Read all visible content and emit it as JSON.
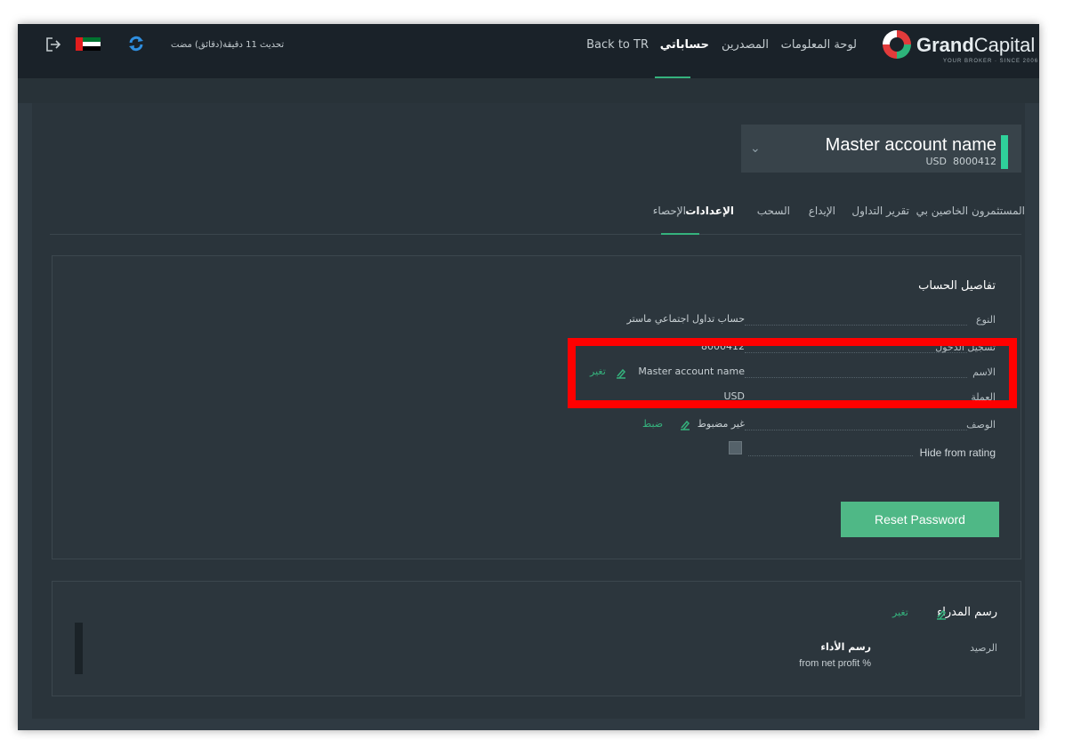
{
  "brand": {
    "name_bold": "Grand",
    "name_light": "Capital",
    "tagline": "YOUR BROKER · SINCE 2006"
  },
  "nav": {
    "dashboard": "لوحة المعلومات",
    "sources": "المصدرين",
    "my_accounts": "حساباتي",
    "back": "Back to TR"
  },
  "sync_status": "تحديث 11 دقيقة(دقائق) مضت",
  "account": {
    "name": "Master account name",
    "currency": "USD",
    "number": "8000412"
  },
  "tabs": [
    "المستثمرون الخاصين بي",
    "تقرير التداول",
    "الإيداع",
    "السحب",
    "الإعدادات",
    "الإحصاء"
  ],
  "details": {
    "title": "تفاصيل الحساب",
    "rows": [
      {
        "label": "النوع",
        "value": "حساب تداول اجتماعي ماستر"
      },
      {
        "label": "تسجيل الدخول",
        "value": "8000412"
      },
      {
        "label": "الاسم",
        "value": "Master account name",
        "edit": "تغير"
      },
      {
        "label": "العملة",
        "value": "USD"
      },
      {
        "label": "الوصف",
        "value": "غير مضبوط",
        "edit": "ضبط"
      },
      {
        "label": "Hide from rating"
      }
    ],
    "reset_button": "Reset Password"
  },
  "fee": {
    "title": "رسم المدراء",
    "edit": "تغير",
    "balance_label": "الرصيد",
    "perf_label": "رسم الأداء",
    "perf_sub": "from net profit %"
  },
  "colors": {
    "accent": "#35b27d",
    "button": "#4fb886",
    "highlight": "#ff0000",
    "background": "#2f3a42"
  },
  "icons": [
    "logout-icon",
    "uae-flag-icon",
    "sync-icon",
    "logo-icon",
    "chevron-down-icon",
    "edit-icon"
  ]
}
